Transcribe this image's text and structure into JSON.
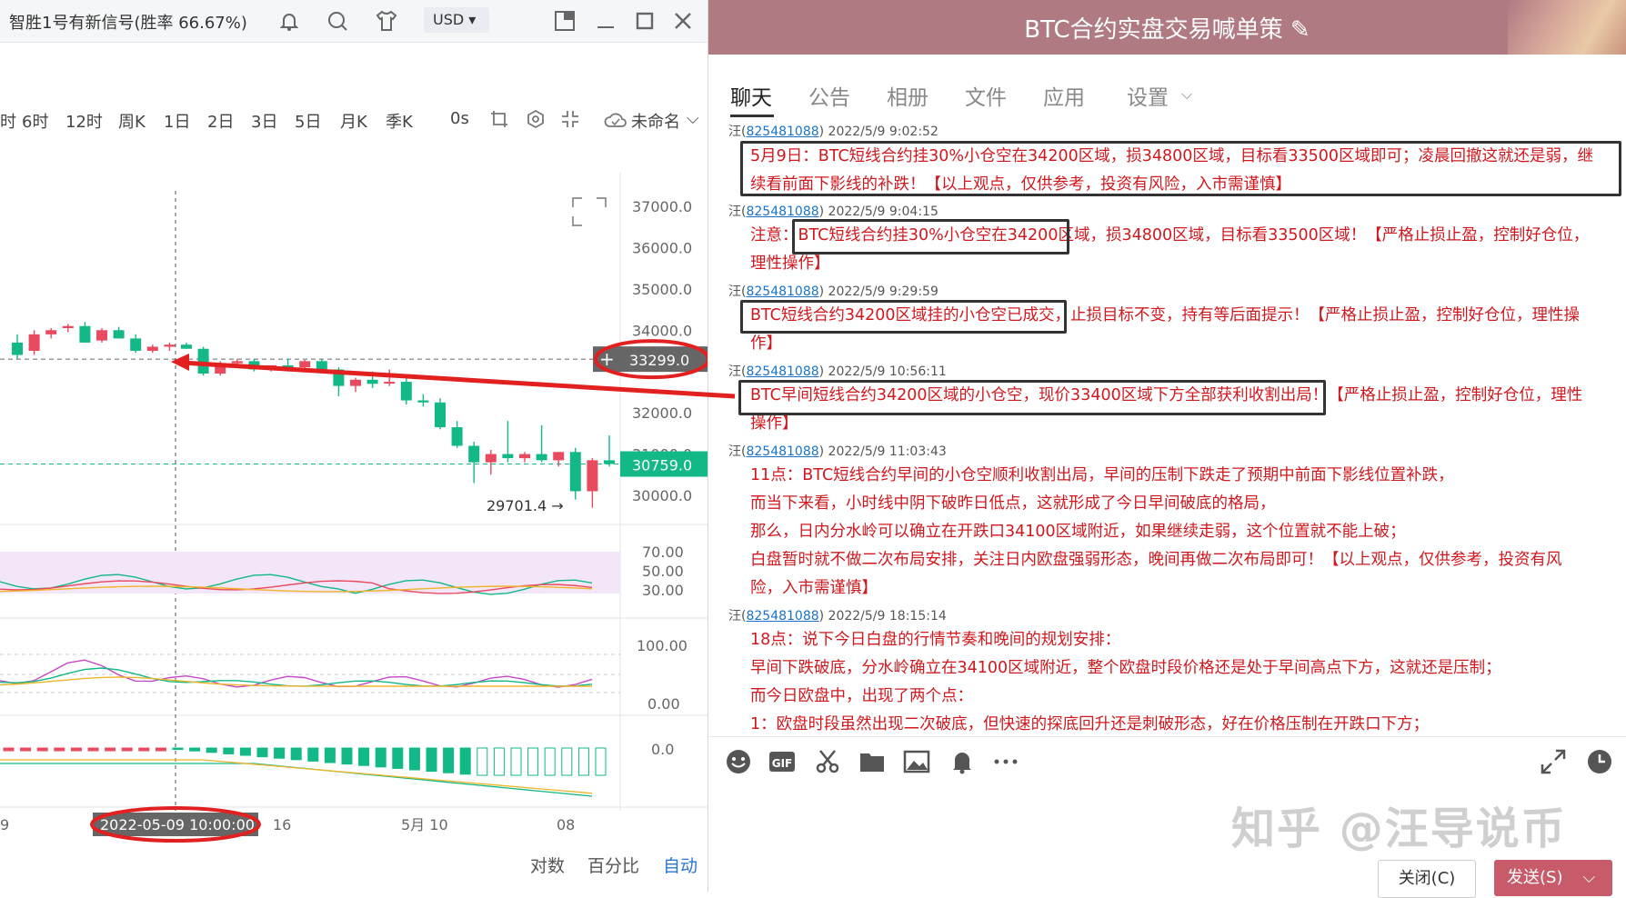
{
  "left_window": {
    "title": "智胜1号有新信号(胜率 66.67%)",
    "currency": "USD",
    "timeframes": [
      "时",
      "6时",
      "12时",
      "周K",
      "1日",
      "2日",
      "3日",
      "5日",
      "月K",
      "季K",
      "0s"
    ],
    "layout_name": "未命名",
    "bottom": {
      "log": "对数",
      "percent": "百分比",
      "auto": "自动"
    }
  },
  "chart_data": {
    "type": "candlestick",
    "y_ticks": [
      "37000.0",
      "36000.0",
      "35000.0",
      "34000.0",
      "33299.0",
      "32000.0",
      "31000.0",
      "30759.0",
      "30000.0"
    ],
    "current_price": "33299.0",
    "last_price": "30759.0",
    "low_label": "29701.4",
    "osc1_ticks": [
      "70.00",
      "50.00",
      "30.00"
    ],
    "osc2_ticks": [
      "100.00",
      "0.00"
    ],
    "macd_ticks": [
      "0.0"
    ],
    "x_labels": [
      "9",
      "16",
      "5月 10",
      "08"
    ],
    "crosshair_time": "2022-05-09 10:00:00",
    "colors": {
      "up": "#e84a5f",
      "down": "#12b886",
      "accent": "#2a75d5"
    },
    "candles": [
      {
        "o": 33700,
        "h": 33900,
        "l": 33300,
        "c": 33400
      },
      {
        "o": 33500,
        "h": 34000,
        "l": 33400,
        "c": 33900
      },
      {
        "o": 33900,
        "h": 34050,
        "l": 33800,
        "c": 34000
      },
      {
        "o": 34050,
        "h": 34150,
        "l": 33950,
        "c": 34100
      },
      {
        "o": 34100,
        "h": 34200,
        "l": 33950,
        "c": 33700
      },
      {
        "o": 33750,
        "h": 34050,
        "l": 33700,
        "c": 34000
      },
      {
        "o": 34000,
        "h": 34080,
        "l": 33800,
        "c": 33800
      },
      {
        "o": 33800,
        "h": 33900,
        "l": 33450,
        "c": 33500
      },
      {
        "o": 33500,
        "h": 33650,
        "l": 33450,
        "c": 33600
      },
      {
        "o": 33600,
        "h": 33700,
        "l": 33500,
        "c": 33650
      },
      {
        "o": 33650,
        "h": 33700,
        "l": 33550,
        "c": 33550
      },
      {
        "o": 33550,
        "h": 33600,
        "l": 32900,
        "c": 32950
      },
      {
        "o": 32950,
        "h": 33250,
        "l": 32900,
        "c": 33200
      },
      {
        "o": 33200,
        "h": 33300,
        "l": 33100,
        "c": 33250
      },
      {
        "o": 33250,
        "h": 33300,
        "l": 33000,
        "c": 33050
      },
      {
        "o": 33050,
        "h": 33150,
        "l": 33000,
        "c": 33150
      },
      {
        "o": 33150,
        "h": 33300,
        "l": 33050,
        "c": 33100
      },
      {
        "o": 33100,
        "h": 33280,
        "l": 33050,
        "c": 33250
      },
      {
        "o": 33250,
        "h": 33300,
        "l": 33000,
        "c": 33050
      },
      {
        "o": 33050,
        "h": 33100,
        "l": 32400,
        "c": 32650
      },
      {
        "o": 32650,
        "h": 32850,
        "l": 32500,
        "c": 32800
      },
      {
        "o": 32800,
        "h": 33000,
        "l": 32600,
        "c": 32700
      },
      {
        "o": 32750,
        "h": 33050,
        "l": 32650,
        "c": 32750
      },
      {
        "o": 32750,
        "h": 32850,
        "l": 32200,
        "c": 32300
      },
      {
        "o": 32300,
        "h": 32450,
        "l": 32150,
        "c": 32250
      },
      {
        "o": 32250,
        "h": 32350,
        "l": 31600,
        "c": 31650
      },
      {
        "o": 31650,
        "h": 31800,
        "l": 31150,
        "c": 31200
      },
      {
        "o": 31200,
        "h": 31300,
        "l": 30300,
        "c": 30800
      },
      {
        "o": 30800,
        "h": 31100,
        "l": 30500,
        "c": 31000
      },
      {
        "o": 31000,
        "h": 31800,
        "l": 30800,
        "c": 30900
      },
      {
        "o": 30900,
        "h": 31050,
        "l": 30800,
        "c": 31000
      },
      {
        "o": 31000,
        "h": 31700,
        "l": 30800,
        "c": 30850
      },
      {
        "o": 30850,
        "h": 31050,
        "l": 30700,
        "c": 31050
      },
      {
        "o": 31050,
        "h": 31150,
        "l": 29900,
        "c": 30100
      },
      {
        "o": 30100,
        "h": 30900,
        "l": 29700,
        "c": 30850
      },
      {
        "o": 30850,
        "h": 31450,
        "l": 30700,
        "c": 30760
      }
    ]
  },
  "chat": {
    "group_title": "BTC合约实盘交易喊单策",
    "tabs": [
      "聊天",
      "公告",
      "相册",
      "文件",
      "应用",
      "设置"
    ],
    "messages": [
      {
        "sender": "汪(",
        "uid": "825481088",
        "time": ") 2022/5/9 9:02:52",
        "lines": [
          "5月9日：BTC短线合约挂30%小仓空在34200区域，损34800区域，目标看33500区域即可；凌晨回撤这就还是弱，继",
          "续看前面下影线的补跌！【以上观点，仅供参考，投资有风险，入市需谨慎】"
        ]
      },
      {
        "sender": "汪(",
        "uid": "825481088",
        "time": ") 2022/5/9 9:04:15",
        "lines": [
          "注意：BTC短线合约挂30%小仓空在34200区域，损34800区域，目标看33500区域！【严格止损止盈，控制好仓位，",
          "理性操作】"
        ]
      },
      {
        "sender": "汪(",
        "uid": "825481088",
        "time": ") 2022/5/9 9:29:59",
        "lines": [
          "BTC短线合约34200区域挂的小仓空已成交，止损目标不变，持有等后面提示！【严格止损止盈，控制好仓位，理性操",
          "作】"
        ]
      },
      {
        "sender": "汪(",
        "uid": "825481088",
        "time": ") 2022/5/9 10:56:11",
        "lines": [
          "BTC早间短线合约34200区域的小仓空，现价33400区域下方全部获利收割出局！【严格止损止盈，控制好仓位，理性",
          "操作】"
        ]
      },
      {
        "sender": "汪(",
        "uid": "825481088",
        "time": ") 2022/5/9 11:03:43",
        "lines": [
          "11点：BTC短线合约早间的小仓空顺利收割出局，早间的压制下跌走了预期中前面下影线位置补跌，",
          "而当下来看，小时线中阴下破昨日低点，这就形成了今日早间破底的格局，",
          "那么，日内分水岭可以确立在开跌口34100区域附近，如果继续走弱，这个位置就不能上破；",
          "白盘暂时就不做二次布局安排，关注日内欧盘强弱形态，晚间再做二次布局即可！【以上观点，仅供参考，投资有风",
          "险，入市需谨慎】"
        ]
      },
      {
        "sender": "汪(",
        "uid": "825481088",
        "time": ") 2022/5/9 18:15:14",
        "lines": [
          "18点：说下今日白盘的行情节奏和晚间的规划安排：",
          "早间下跌破底，分水岭确立在34100区域附近，整个欧盘时段价格还是处于早间高点下方，这就还是压制；",
          "而今日欧盘中，出现了两个点：",
          "1：欧盘时段虽然出现二次破底，但快速的探底回升还是刺破形态，好在价格压制在开跌口下方；"
        ]
      }
    ],
    "watermark": "知乎 @汪导说币",
    "close_label": "关闭(C)",
    "send_label": "发送(S)"
  }
}
